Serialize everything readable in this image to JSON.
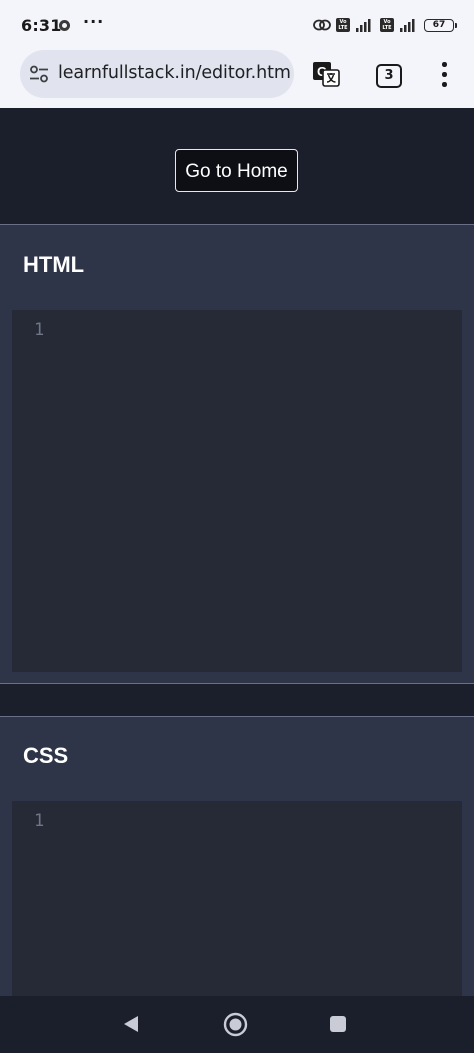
{
  "status_bar": {
    "time": "6:31",
    "more": "···",
    "volte_1": "Vo LTE",
    "volte_2": "Vo LTE",
    "battery": "67"
  },
  "browser": {
    "url": "learnfullstack.in/editor.htm",
    "tab_count": "3"
  },
  "page": {
    "home_button": "Go to Home",
    "html_panel": {
      "title": "HTML",
      "line_number": "1"
    },
    "css_panel": {
      "title": "CSS",
      "line_number": "1"
    }
  },
  "icons": {
    "site_info": "tune-icon",
    "translate": "translate-icon",
    "menu": "more-vert-icon",
    "back": "back-icon",
    "home": "home-circle-icon",
    "recents": "recents-square-icon"
  }
}
